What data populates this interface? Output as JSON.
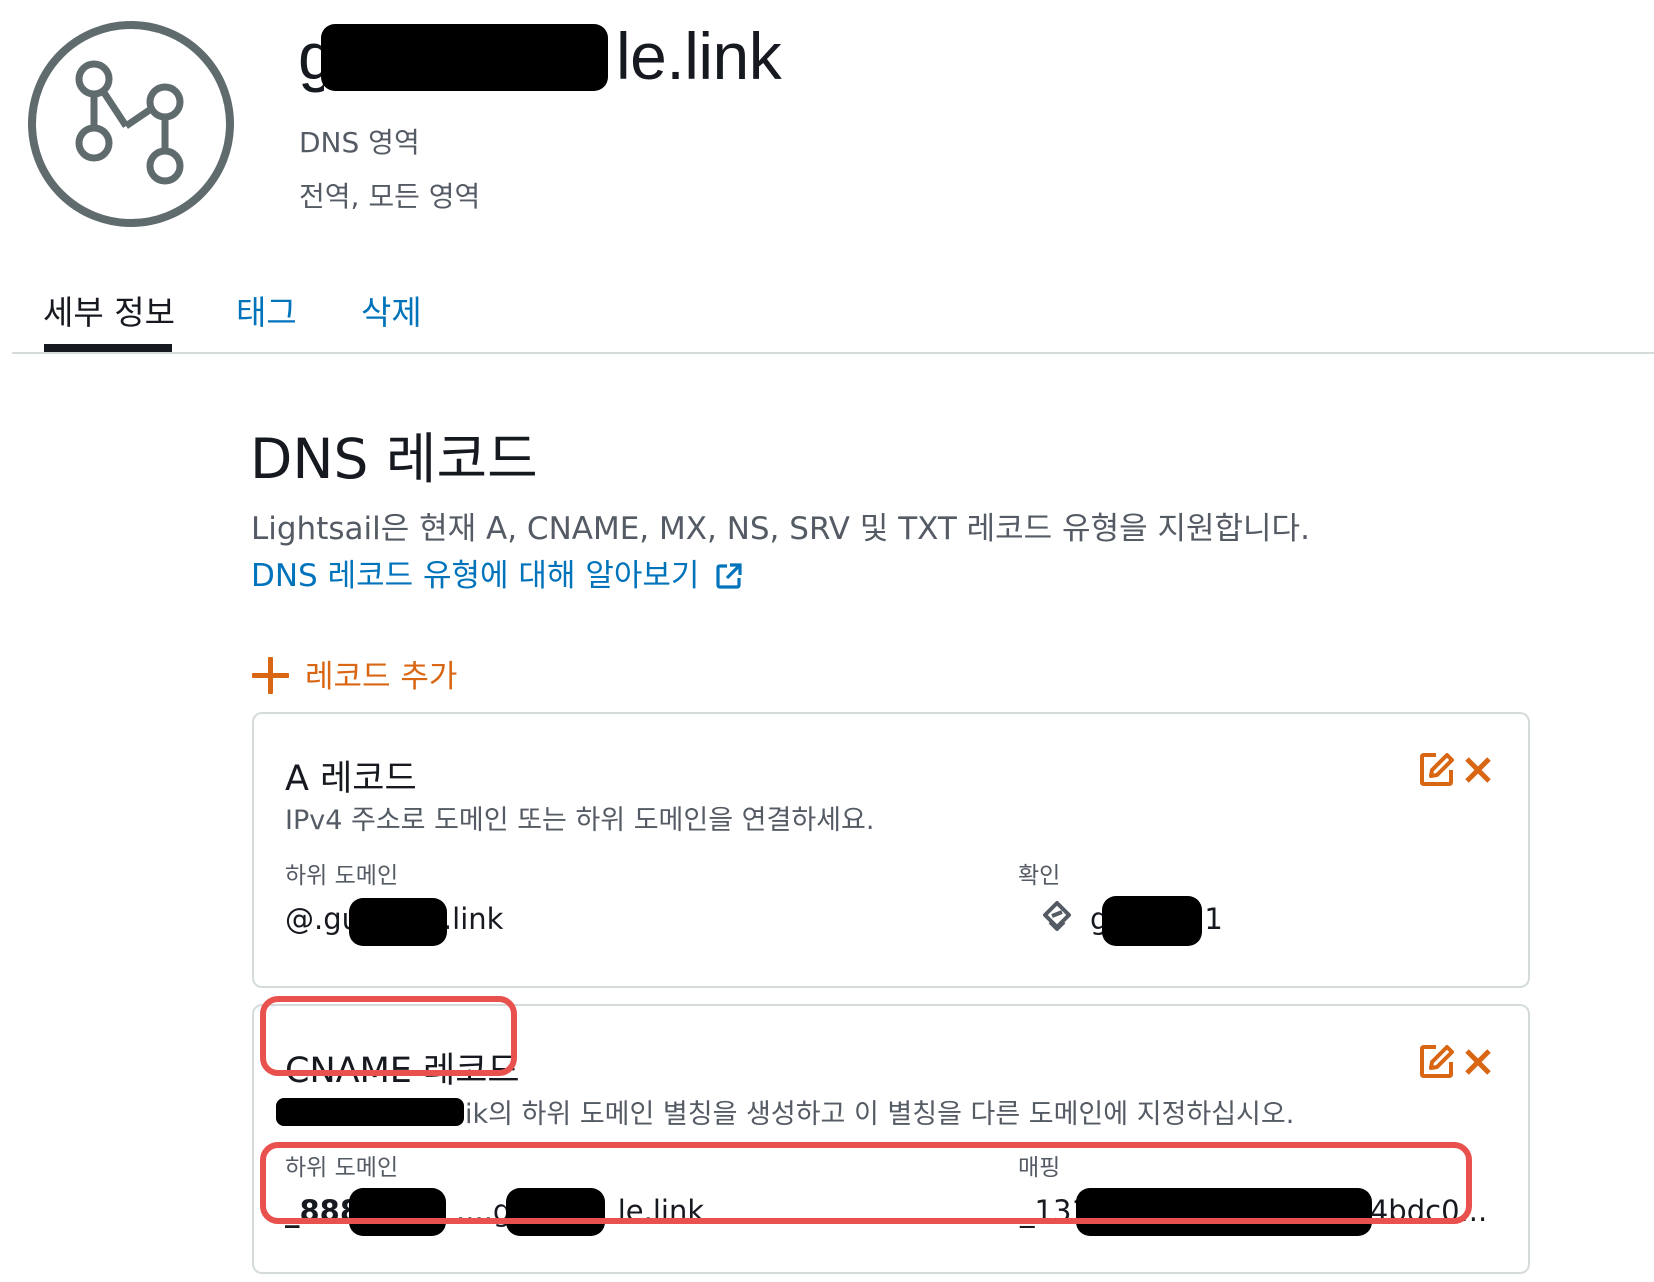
{
  "header": {
    "title_prefix": "g",
    "title_suffix": "le.link",
    "subtitle_type": "DNS 영역",
    "subtitle_scope": "전역, 모든 영역",
    "icon": "dns-zone-icon"
  },
  "tabs": [
    {
      "label": "세부 정보",
      "active": true
    },
    {
      "label": "태그",
      "active": false
    },
    {
      "label": "삭제",
      "active": false
    }
  ],
  "dns_section": {
    "title": "DNS 레코드",
    "description": "Lightsail은 현재 A, CNAME, MX, NS, SRV 및 TXT 레코드 유형을 지원합니다.",
    "learn_link": "DNS 레코드 유형에 대해 알아보기",
    "add_record": "레코드 추가"
  },
  "records": [
    {
      "title": "A 레코드",
      "description": "IPv4 주소로 도메인 또는 하위 도메인을 연결하세요.",
      "subdomain_label": "하위 도메인",
      "subdomain_prefix": "@.gu",
      "subdomain_suffix": "le.link",
      "target_label": "확인",
      "target_prefix": "g",
      "target_suffix": "1",
      "target_icon": "lightsail-instance-icon"
    },
    {
      "title": "CNAME 레코드",
      "description_suffix": "ik의 하위 도메인 별칭을 생성하고 이 별칭을 다른 도메인에 지정하십시오.",
      "subdomain_label": "하위 도메인",
      "subdomain_prefix": "_888",
      "subdomain_middle": "....gu",
      "subdomain_suffix": "le.link",
      "target_label": "매핑",
      "target_prefix": "_131",
      "target_suffix": "4bdc0..."
    }
  ],
  "colors": {
    "accent_orange": "#d86613",
    "link_blue": "#0073bb",
    "highlight_red": "#e8514d"
  }
}
